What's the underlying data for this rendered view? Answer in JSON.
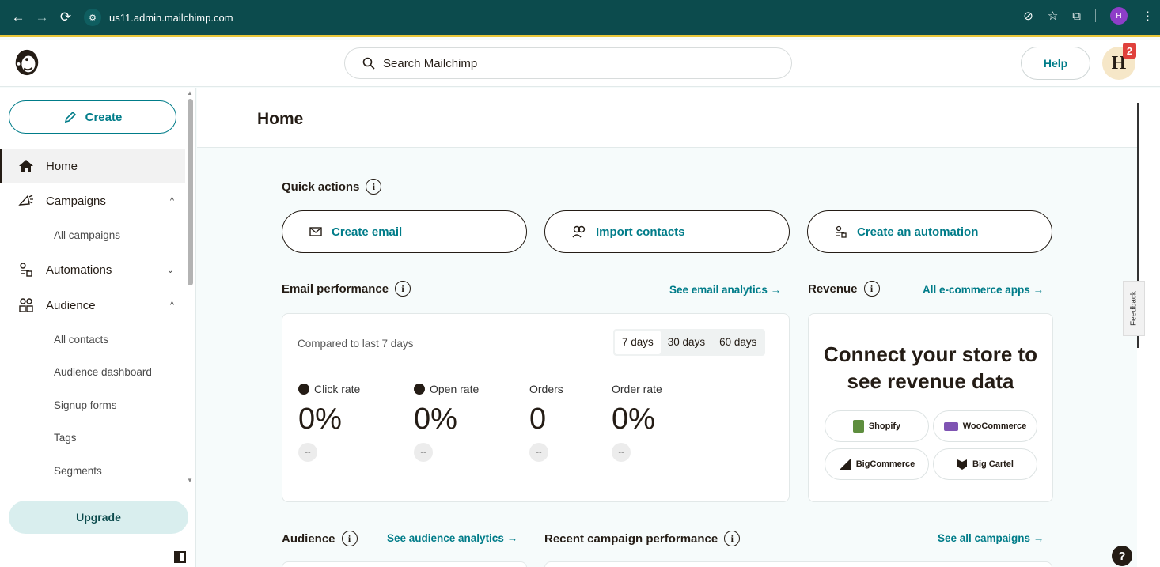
{
  "browser": {
    "url": "us11.admin.mailchimp.com",
    "profile_initial": "H"
  },
  "header": {
    "search_placeholder": "Search Mailchimp",
    "help_label": "Help",
    "avatar_initial": "H",
    "notification_count": "2"
  },
  "sidebar": {
    "create_label": "Create",
    "items": [
      {
        "label": "Home",
        "icon": "home-icon",
        "active": true
      },
      {
        "label": "Campaigns",
        "icon": "megaphone-icon",
        "expanded": true
      },
      {
        "label": "Automations",
        "icon": "automations-icon",
        "expanded": false
      },
      {
        "label": "Audience",
        "icon": "audience-icon",
        "expanded": true
      }
    ],
    "campaigns_sub": [
      "All campaigns"
    ],
    "audience_sub": [
      "All contacts",
      "Audience dashboard",
      "Signup forms",
      "Tags",
      "Segments"
    ],
    "upgrade_label": "Upgrade"
  },
  "main": {
    "page_title": "Home",
    "quick_actions": {
      "label": "Quick actions",
      "buttons": [
        "Create email",
        "Import contacts",
        "Create an automation"
      ]
    },
    "email_performance": {
      "label": "Email performance",
      "link": "See email analytics →",
      "compared": "Compared to last 7 days",
      "ranges": [
        "7 days",
        "30 days",
        "60 days"
      ],
      "selected_range": "7 days",
      "metrics": [
        {
          "label": "Click rate",
          "value": "0%",
          "delta": "--"
        },
        {
          "label": "Open rate",
          "value": "0%",
          "delta": "--"
        },
        {
          "label": "Orders",
          "value": "0",
          "delta": "--"
        },
        {
          "label": "Order rate",
          "value": "0%",
          "delta": "--"
        }
      ]
    },
    "revenue": {
      "label": "Revenue",
      "link": "All e-commerce apps →",
      "headline": "Connect your store to see revenue data",
      "stores": [
        "Shopify",
        "WooCommerce",
        "BigCommerce",
        "Big Cartel"
      ]
    },
    "audience": {
      "label": "Audience",
      "link": "See audience analytics →"
    },
    "recent_campaigns": {
      "label": "Recent campaign performance",
      "link": "See all campaigns →"
    },
    "feedback_label": "Feedback",
    "help_bubble": "?"
  },
  "colors": {
    "browser_bar": "#0c4b4d",
    "accent": "#007c89",
    "brand_dark": "#241c15",
    "upgrade_bg": "#d9eeee"
  }
}
